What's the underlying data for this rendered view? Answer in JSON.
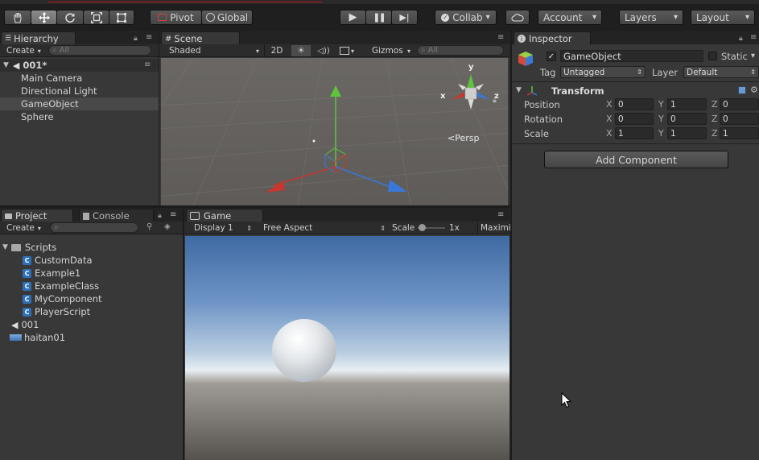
{
  "toolbar": {
    "pivot_label": "Pivot",
    "global_label": "Global",
    "collab_label": "Collab",
    "account_label": "Account",
    "layers_label": "Layers",
    "layout_label": "Layout",
    "dropdown_glyph": "▾",
    "play_glyph": "▶",
    "pause_glyph": "❚❚",
    "step_glyph": "▶|"
  },
  "hierarchy": {
    "tab_label": "Hierarchy",
    "create_label": "Create",
    "search_placeholder": "All",
    "scene_name": "001*",
    "items": [
      "Main Camera",
      "Directional Light",
      "GameObject",
      "Sphere"
    ]
  },
  "scene": {
    "tab_label": "Scene",
    "shading_label": "Shaded",
    "mode_2d_label": "2D",
    "gizmos_label": "Gizmos",
    "search_placeholder": "All",
    "persp_label": "Persp",
    "gizmo_y_label": "y",
    "gizmo_x_label": "x",
    "gizmo_z_label": "z"
  },
  "project": {
    "tab_label": "Project",
    "console_tab_label": "Console",
    "create_label": "Create",
    "folder": "Scripts",
    "scripts": [
      "CustomData",
      "Example1",
      "ExampleClass",
      "MyComponent",
      "PlayerScript"
    ],
    "scene_asset": "001",
    "terrain_asset": "haitan01"
  },
  "game": {
    "tab_label": "Game",
    "display_label": "Display 1",
    "aspect_label": "Free Aspect",
    "scale_label": "Scale",
    "scale_value": "1x",
    "maximize_label": "Maximi"
  },
  "inspector": {
    "tab_label": "Inspector",
    "object_name": "GameObject",
    "static_label": "Static",
    "tag_label": "Tag",
    "tag_value": "Untagged",
    "layer_label": "Layer",
    "layer_value": "Default",
    "transform_label": "Transform",
    "axis_x": "X",
    "axis_y": "Y",
    "axis_z": "Z",
    "position_label": "Position",
    "position": [
      "0",
      "1",
      "0"
    ],
    "rotation_label": "Rotation",
    "rotation": [
      "0",
      "0",
      "0"
    ],
    "scale_label": "Scale",
    "scale": [
      "1",
      "1",
      "1"
    ],
    "add_component_label": "Add Component"
  },
  "colors": {
    "axis_y": "#5fc43c",
    "axis_x": "#c8372d",
    "axis_z": "#3a78d8",
    "panel_bg": "#383838",
    "selection": "#484848"
  }
}
